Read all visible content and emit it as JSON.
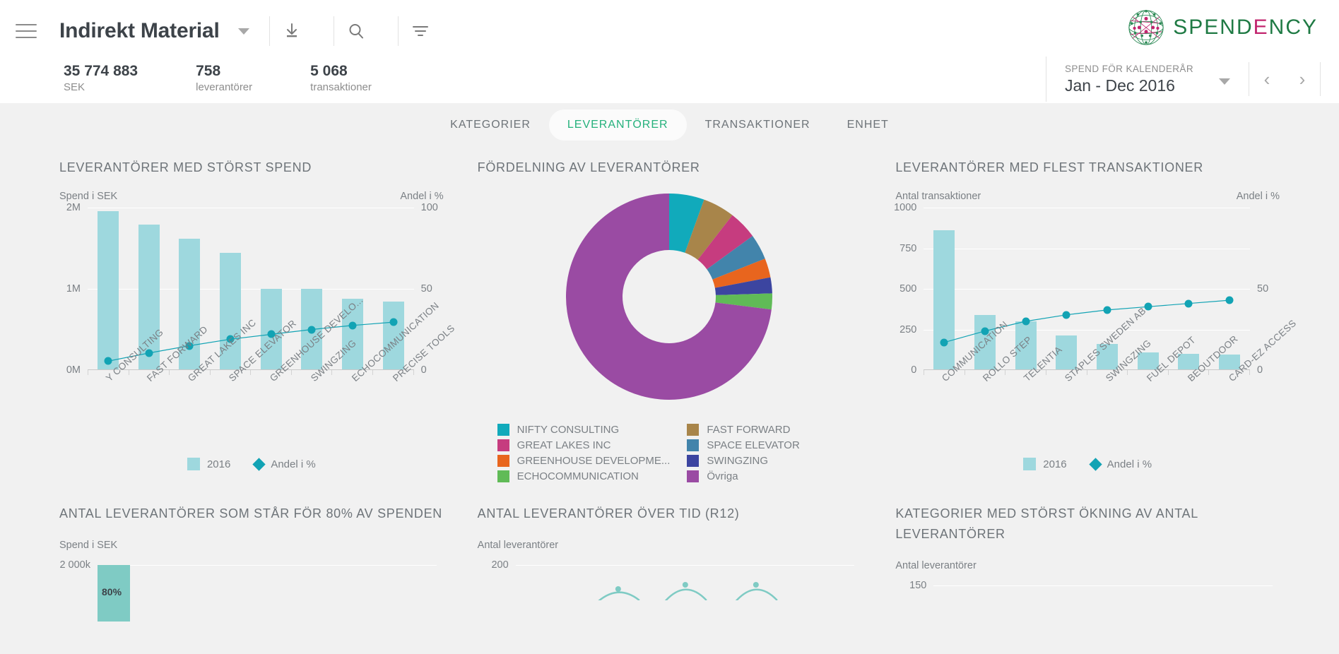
{
  "header": {
    "menu_icon": "hamburger-icon",
    "title": "Indirekt Material",
    "download_icon": "download-icon",
    "search_icon": "search-icon",
    "filter_icon": "filter-icon",
    "logo_text_1": "SPEND",
    "logo_text_e": "E",
    "logo_text_2": "NCY",
    "logo_green": "#1f7a44",
    "logo_pink": "#c2256e"
  },
  "kpis": [
    {
      "value": "35 774 883",
      "label": "SEK"
    },
    {
      "value": "758",
      "label": "leverantörer"
    },
    {
      "value": "5 068",
      "label": "transaktioner"
    }
  ],
  "period": {
    "label": "SPEND FÖR KALENDERÅR",
    "value": "Jan - Dec 2016",
    "prev": "‹",
    "next": "›"
  },
  "tabs": [
    {
      "label": "KATEGORIER",
      "active": false
    },
    {
      "label": "LEVERANTÖRER",
      "active": true
    },
    {
      "label": "TRANSAKTIONER",
      "active": false
    },
    {
      "label": "ENHET",
      "active": false
    }
  ],
  "accent_green": "#25b17c",
  "bar_color": "#9ed8de",
  "line_color": "#12a3b4",
  "chart_data": [
    {
      "id": "top-suppliers-spend",
      "type": "bar",
      "title": "LEVERANTÖRER MED STÖRST SPEND",
      "ylabel": "Spend i SEK",
      "y2label": "Andel i %",
      "categories": [
        "Y CONSULTING",
        "FAST FORWARD",
        "GREAT LAKES INC",
        "SPACE ELEVATOR",
        "GREENHOUSE DEVELO...",
        "SWINGZING",
        "ECHOCOMMUNICATION",
        "PRECISE TOOLS"
      ],
      "values": [
        1960000,
        1790000,
        1620000,
        1440000,
        1000000,
        1000000,
        880000,
        840000
      ],
      "ylim": [
        0,
        2000000
      ],
      "yticks": [
        "0M",
        "1M",
        "2M"
      ],
      "y2lim": [
        0,
        100
      ],
      "y2ticks": [
        "0",
        "50",
        "100"
      ],
      "series": [
        {
          "name": "2016",
          "type": "bar",
          "values": [
            1960000,
            1790000,
            1620000,
            1440000,
            1000000,
            1000000,
            880000,
            840000
          ]
        },
        {
          "name": "Andel i %",
          "type": "line",
          "values": [
            5.5,
            10.5,
            15.0,
            19.0,
            22.0,
            25.0,
            27.5,
            29.5
          ]
        }
      ],
      "legend": [
        {
          "label": "2016",
          "marker": "square"
        },
        {
          "label": "Andel i %",
          "marker": "diamond"
        }
      ]
    },
    {
      "id": "supplier-distribution",
      "type": "pie",
      "title": "FÖRDELNING AV LEVERANTÖRER",
      "labels": [
        "NIFTY CONSULTING",
        "FAST FORWARD",
        "GREAT LAKES INC",
        "SPACE ELEVATOR",
        "GREENHOUSE DEVELOPME...",
        "SWINGZING",
        "ECHOCOMMUNICATION",
        "Övriga"
      ],
      "values": [
        5.5,
        5.0,
        4.5,
        4.0,
        3.0,
        2.5,
        2.5,
        73.0
      ],
      "colors": [
        "#11aabb",
        "#a8854a",
        "#c63c7f",
        "#4284ab",
        "#e8651e",
        "#3c45a0",
        "#60bb57",
        "#9a4ba3"
      ],
      "legend_left": [
        "NIFTY CONSULTING",
        "GREAT LAKES INC",
        "GREENHOUSE DEVELOPME...",
        "ECHOCOMMUNICATION"
      ],
      "legend_right": [
        "FAST FORWARD",
        "SPACE ELEVATOR",
        "SWINGZING",
        "Övriga"
      ],
      "legend_left_colors": [
        "#11aabb",
        "#c63c7f",
        "#e8651e",
        "#60bb57"
      ],
      "legend_right_colors": [
        "#a8854a",
        "#4284ab",
        "#3c45a0",
        "#9a4ba3"
      ]
    },
    {
      "id": "top-suppliers-transactions",
      "type": "bar",
      "title": "LEVERANTÖRER MED FLEST TRANSAKTIONER",
      "ylabel": "Antal transaktioner",
      "y2label": "Andel i %",
      "categories": [
        "COMMUNICATION",
        "ROLLO STEP",
        "TELENTIA",
        "STAPLES SWEDEN AB",
        "SWINGZING",
        "FUEL DEPOT",
        "BEOUTDOOR",
        "CARD-EZ ACCESS"
      ],
      "values": [
        860,
        340,
        300,
        215,
        160,
        110,
        100,
        95
      ],
      "ylim": [
        0,
        1000
      ],
      "yticks": [
        "0",
        "250",
        "500",
        "750",
        "1000"
      ],
      "y2lim": [
        0,
        100
      ],
      "y2ticks": [
        "0",
        "50"
      ],
      "series": [
        {
          "name": "2016",
          "type": "bar",
          "values": [
            860,
            340,
            300,
            215,
            160,
            110,
            100,
            95
          ]
        },
        {
          "name": "Andel i %",
          "type": "line",
          "values": [
            17,
            24,
            30,
            34,
            37,
            39,
            41,
            43
          ]
        }
      ],
      "legend": [
        {
          "label": "2016",
          "marker": "square"
        },
        {
          "label": "Andel i %",
          "marker": "diamond"
        }
      ]
    },
    {
      "id": "suppliers-80pct",
      "type": "bar",
      "title": "ANTAL LEVERANTÖRER SOM STÅR FÖR 80% AV SPENDEN",
      "ylabel": "Spend i SEK",
      "yticks": [
        "2 000k"
      ],
      "annotation": "80%"
    },
    {
      "id": "suppliers-over-time",
      "type": "line",
      "title": "ANTAL LEVERANTÖRER ÖVER TID (R12)",
      "ylabel": "Antal leverantörer",
      "yticks": [
        "200"
      ]
    },
    {
      "id": "categories-increase-suppliers",
      "type": "bar",
      "title_line1": "KATEGORIER MED STÖRST ÖKNING AV ANTAL",
      "title_line2": "LEVERANTÖRER",
      "ylabel": "Antal leverantörer",
      "yticks": [
        "150"
      ]
    }
  ]
}
